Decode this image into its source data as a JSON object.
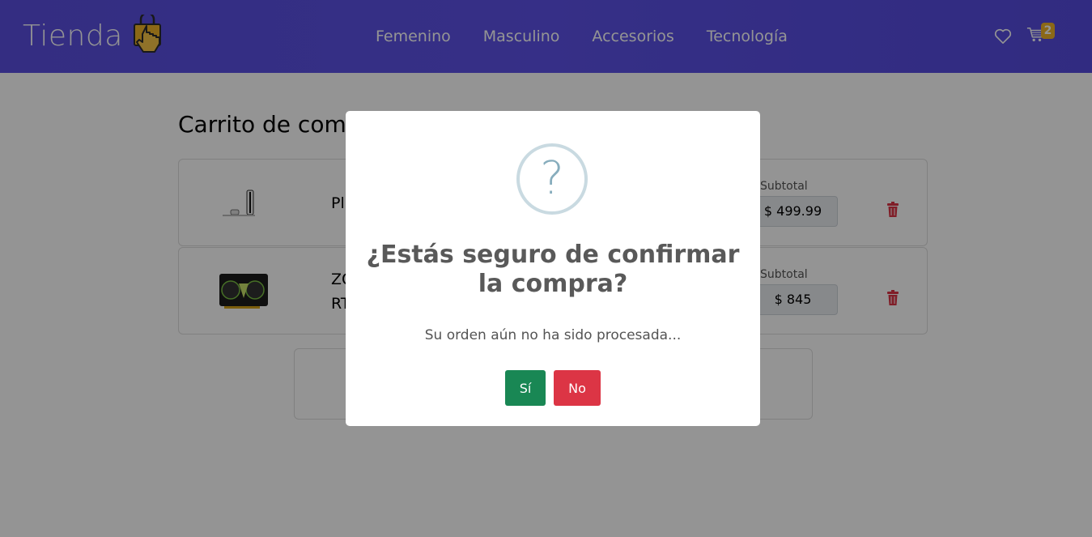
{
  "navbar": {
    "brand": "Tienda",
    "links": [
      "Femenino",
      "Masculino",
      "Accesorios",
      "Tecnología"
    ],
    "cart_count": "2"
  },
  "page": {
    "title": "Carrito de compras",
    "items": [
      {
        "name_visible": "Pl",
        "subtotal_label": "Subtotal",
        "subtotal": "$ 499.99"
      },
      {
        "name_line1": "ZO",
        "name_line2": "RT",
        "subtotal_label": "Subtotal",
        "subtotal": "$ 845"
      }
    ]
  },
  "modal": {
    "icon": "?",
    "title": "¿Estás seguro de confirmar la compra?",
    "text": "Su orden aún no ha sido procesada...",
    "confirm_label": "Sí",
    "cancel_label": "No"
  },
  "colors": {
    "navbar": "#5a4fe0",
    "badge": "#f0b429",
    "confirm": "#198754",
    "cancel": "#dc3545",
    "trash": "#dc3545"
  }
}
